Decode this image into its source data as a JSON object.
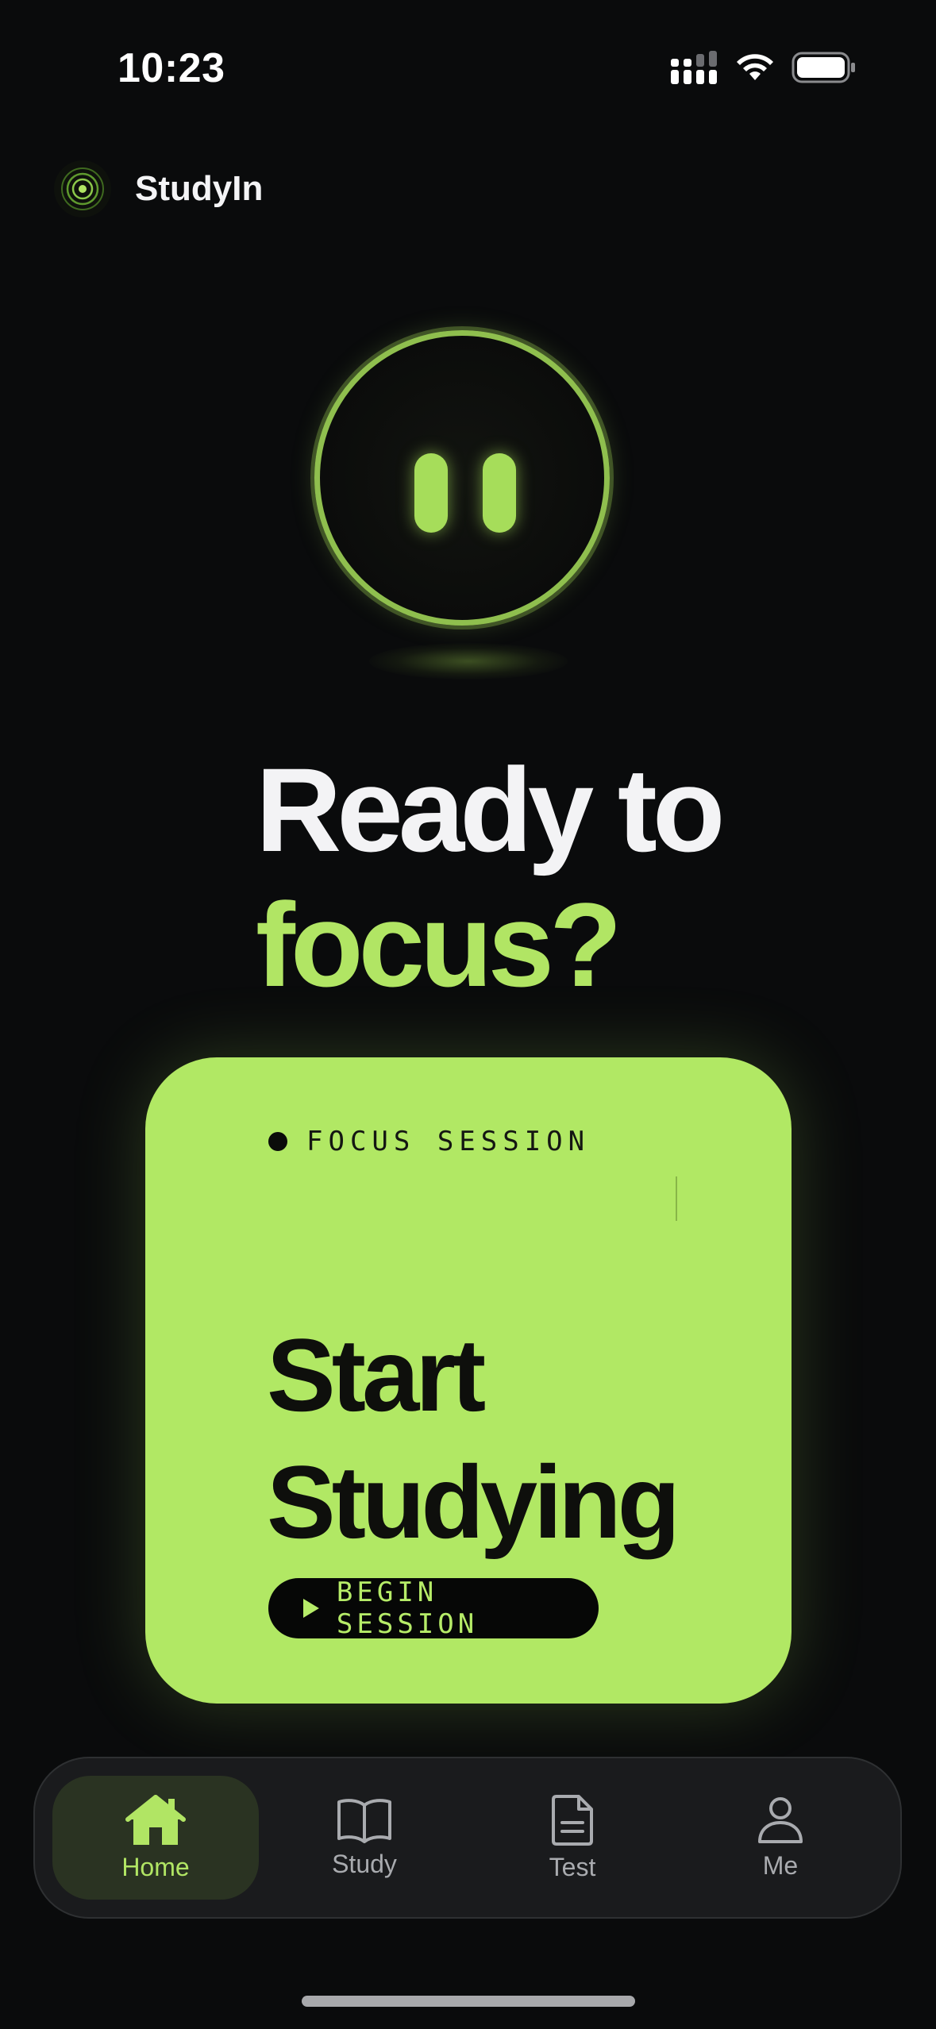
{
  "status_bar": {
    "time": "10:23",
    "icons": [
      "signal-icon",
      "wifi-icon",
      "battery-icon"
    ]
  },
  "header": {
    "app_name": "StudyIn",
    "logo_icon": "target-rings-icon"
  },
  "hero": {
    "icon": "pause-icon",
    "headline_line1": "Ready to",
    "headline_line2": "focus?"
  },
  "card": {
    "eyebrow": "FOCUS SESSION",
    "title_line1": "Start",
    "title_line2": "Studying",
    "button_label": "BEGIN SESSION",
    "button_icon": "play-icon"
  },
  "tabs": [
    {
      "label": "Home",
      "icon": "home-icon",
      "active": true
    },
    {
      "label": "Study",
      "icon": "book-icon",
      "active": false
    },
    {
      "label": "Test",
      "icon": "document-icon",
      "active": false
    },
    {
      "label": "Me",
      "icon": "person-icon",
      "active": false
    }
  ],
  "colors": {
    "background": "#0a0b0c",
    "accent": "#b1e864",
    "accent_text": "#b1e564",
    "tabbar": "#1a1b1d",
    "tab_active_bg": "#2a3322"
  }
}
